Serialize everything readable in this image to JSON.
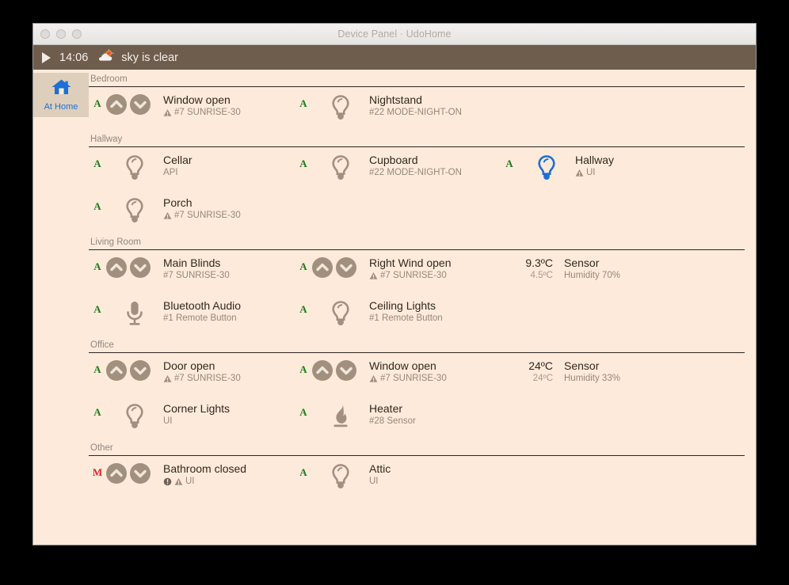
{
  "window": {
    "title": "Device Panel · UdoHome",
    "traffic_buttons": [
      "close",
      "minimize",
      "maximize"
    ]
  },
  "toolbar": {
    "play_label": "play-button",
    "time": "14:06",
    "weather_icon": "cloud-sun-icon",
    "weather_text": "sky is clear"
  },
  "sidebar": {
    "items": [
      {
        "icon": "home-icon",
        "label": "At Home",
        "active": true
      }
    ]
  },
  "colors": {
    "window_bg": "#fdeada",
    "toolbar_bg": "#6e5c4d",
    "sidebar_active_bg": "#ddcfbc",
    "accent_blue": "#1d6fd4",
    "mode_auto_green": "#1d7c1d",
    "mode_manual_red": "#e0222b",
    "icon_brown": "#a2907f",
    "separator": "#2b2522"
  },
  "sections": [
    {
      "title": "Bedroom",
      "rows": [
        {
          "cells": [
            {
              "mode": "A",
              "control": "updown",
              "icon": "chevron-up-down-icon",
              "name": "Window open",
              "sub": "#7 SUNRISE-30",
              "badges": [
                "warning"
              ]
            },
            {
              "mode": "A",
              "control": "single",
              "icon": "bulb-icon",
              "icon_on": false,
              "name": "Nightstand",
              "sub": "#22 MODE-NIGHT-ON",
              "badges": []
            }
          ]
        }
      ]
    },
    {
      "title": "Hallway",
      "rows": [
        {
          "cells": [
            {
              "mode": "A",
              "control": "single",
              "icon": "bulb-icon",
              "icon_on": false,
              "name": "Cellar",
              "sub": "API",
              "badges": []
            },
            {
              "mode": "A",
              "control": "single",
              "icon": "bulb-icon",
              "icon_on": false,
              "name": "Cupboard",
              "sub": "#22 MODE-NIGHT-ON",
              "badges": []
            },
            {
              "mode": "A",
              "control": "single",
              "icon": "bulb-icon",
              "icon_on": true,
              "name": "Hallway",
              "sub": "UI",
              "badges": [
                "warning"
              ]
            }
          ]
        },
        {
          "cells": [
            {
              "mode": "A",
              "control": "single",
              "icon": "bulb-icon",
              "icon_on": false,
              "name": "Porch",
              "sub": "#7 SUNRISE-30",
              "badges": [
                "warning"
              ]
            }
          ]
        }
      ]
    },
    {
      "title": "Living Room",
      "rows": [
        {
          "cells": [
            {
              "mode": "A",
              "control": "updown",
              "icon": "chevron-up-down-icon",
              "name": "Main Blinds",
              "sub": "#7 SUNRISE-30",
              "badges": []
            },
            {
              "mode": "A",
              "control": "updown",
              "icon": "chevron-up-down-icon",
              "name": "Right Wind open",
              "sub": "#7 SUNRISE-30",
              "badges": [
                "warning"
              ]
            }
          ],
          "sensor": {
            "temp_main": "9.3ºC",
            "temp_sub": "4.5ºC",
            "name": "Sensor",
            "sub": "Humidity 70%"
          }
        },
        {
          "cells": [
            {
              "mode": "A",
              "control": "single",
              "icon": "microphone-icon",
              "name": "Bluetooth Audio",
              "sub": "#1 Remote Button",
              "badges": []
            },
            {
              "mode": "A",
              "control": "single",
              "icon": "bulb-icon",
              "icon_on": false,
              "name": "Ceiling Lights",
              "sub": "#1 Remote Button",
              "badges": []
            }
          ]
        }
      ]
    },
    {
      "title": "Office",
      "rows": [
        {
          "cells": [
            {
              "mode": "A",
              "control": "updown",
              "icon": "chevron-up-down-icon",
              "name": "Door open",
              "sub": "#7 SUNRISE-30",
              "badges": [
                "warning"
              ]
            },
            {
              "mode": "A",
              "control": "updown",
              "icon": "chevron-up-down-icon",
              "name": "Window open",
              "sub": "#7 SUNRISE-30",
              "badges": [
                "warning"
              ]
            }
          ],
          "sensor": {
            "temp_main": "24ºC",
            "temp_sub": "24ºC",
            "name": "Sensor",
            "sub": "Humidity 33%"
          }
        },
        {
          "cells": [
            {
              "mode": "A",
              "control": "single",
              "icon": "bulb-icon",
              "icon_on": false,
              "name": "Corner Lights",
              "sub": "UI",
              "badges": []
            },
            {
              "mode": "A",
              "control": "single",
              "icon": "flame-icon",
              "name": "Heater",
              "sub": "#28 Sensor",
              "badges": []
            }
          ]
        }
      ]
    },
    {
      "title": "Other",
      "rows": [
        {
          "cells": [
            {
              "mode": "M",
              "control": "updown",
              "icon": "chevron-up-down-icon",
              "name": "Bathroom closed",
              "sub": "UI",
              "badges": [
                "info",
                "warning"
              ]
            },
            {
              "mode": "A",
              "control": "single",
              "icon": "bulb-icon",
              "icon_on": false,
              "name": "Attic",
              "sub": "UI",
              "badges": []
            }
          ]
        }
      ]
    }
  ]
}
